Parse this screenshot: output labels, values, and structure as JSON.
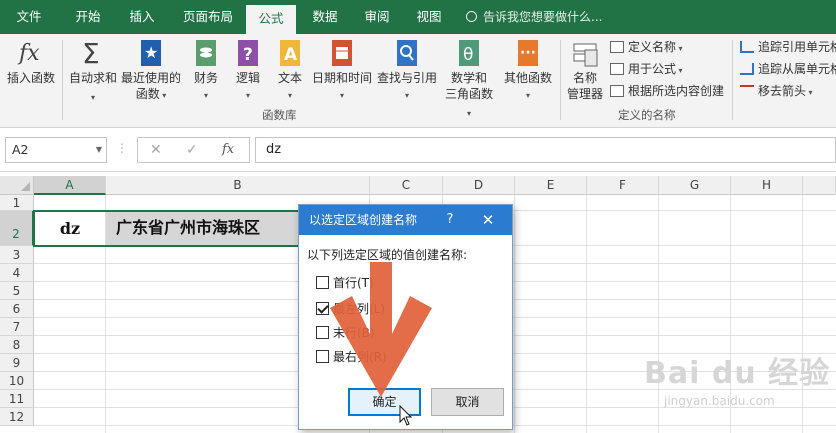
{
  "ribbon_tabs": [
    {
      "label": "文件"
    },
    {
      "label": "开始"
    },
    {
      "label": "插入"
    },
    {
      "label": "页面布局"
    },
    {
      "label": "公式"
    },
    {
      "label": "数据"
    },
    {
      "label": "审阅"
    },
    {
      "label": "视图"
    }
  ],
  "active_tab": "公式",
  "tell_me": "告诉我您想要做什么...",
  "ribbon": {
    "insert_function": "插入函数",
    "autosum": "自动求和",
    "recent_l1": "最近使用的",
    "recent_l2": "函数",
    "financial": "财务",
    "logical": "逻辑",
    "text": "文本",
    "datetime": "日期和时间",
    "lookup": "查找与引用",
    "math_l1": "数学和",
    "math_l2": "三角函数",
    "more": "其他函数",
    "library_label": "函数库",
    "name_mgr_l1": "名称",
    "name_mgr_l2": "管理器",
    "define_name": "定义名称",
    "use_in_formula": "用于公式",
    "create_from_selection": "根据所选内容创建",
    "defined_names_label": "定义的名称",
    "trace_precedents": "追踪引用单元格",
    "trace_dependents": "追踪从属单元格",
    "remove_arrows": "移去箭头"
  },
  "formula_bar": {
    "name_box": "A2",
    "content": "dz"
  },
  "grid": {
    "columns": [
      "A",
      "B",
      "C",
      "D",
      "E",
      "F",
      "G",
      "H"
    ],
    "rows": [
      "1",
      "2",
      "3",
      "4",
      "5",
      "6",
      "7",
      "8",
      "9",
      "10",
      "11",
      "12"
    ],
    "a2": "dz",
    "b2": "广东省广州市海珠区"
  },
  "dialog": {
    "title": "以选定区域创建名称",
    "help": "?",
    "close": "✕",
    "prompt": "以下列选定区域的值创建名称:",
    "options": [
      {
        "label": "首行(T)",
        "checked": false
      },
      {
        "label": "最左列(L)",
        "checked": true
      },
      {
        "label": "末行(B)",
        "checked": false
      },
      {
        "label": "最右列(R)",
        "checked": false
      }
    ],
    "ok": "确定",
    "cancel": "取消"
  },
  "colors": {
    "excel_green": "#217346",
    "dialog_title_blue": "#2b7bd1",
    "arrow_orange": "#e0623a"
  },
  "watermark": {
    "brand": "Bai du 经验",
    "url": "jingyan.baidu.com"
  }
}
